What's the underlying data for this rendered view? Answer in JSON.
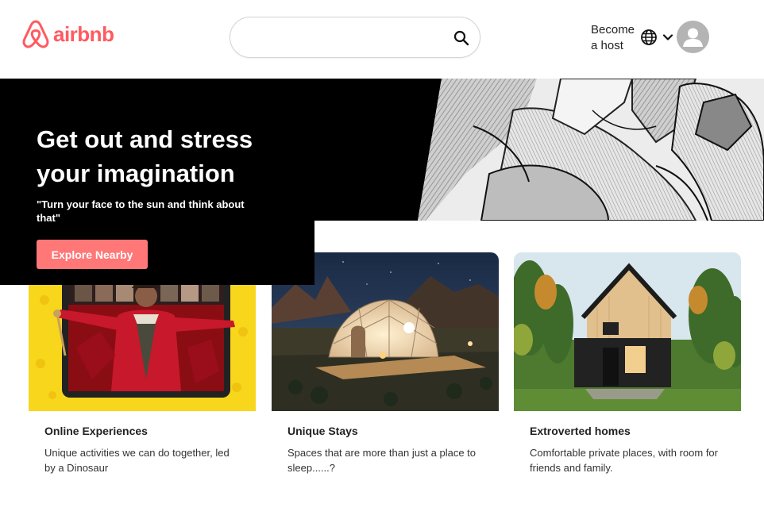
{
  "header": {
    "logo_text": "airbnb",
    "brand_color": "#ff5a5f",
    "search": {
      "placeholder": "",
      "value": "",
      "icon": "search-icon"
    },
    "become_host": "Become a host",
    "language_icon": "globe-icon",
    "menu_icon": "chevron-down-icon",
    "avatar_icon": "user-avatar-icon"
  },
  "hero": {
    "title": "Get out and stress your imagination",
    "quote": "\"Turn your face to the sun and think about that\"",
    "button_label": "Explore Nearby",
    "button_color": "#ff7777"
  },
  "cards": [
    {
      "title": "Online Experiences",
      "description": "Unique activities we can do together, led by a Dinosaur"
    },
    {
      "title": "Unique Stays",
      "description": "Spaces that are more than just a place to sleep......?"
    },
    {
      "title": "Extroverted homes",
      "description": "Comfortable private places, with room for friends and family."
    }
  ]
}
